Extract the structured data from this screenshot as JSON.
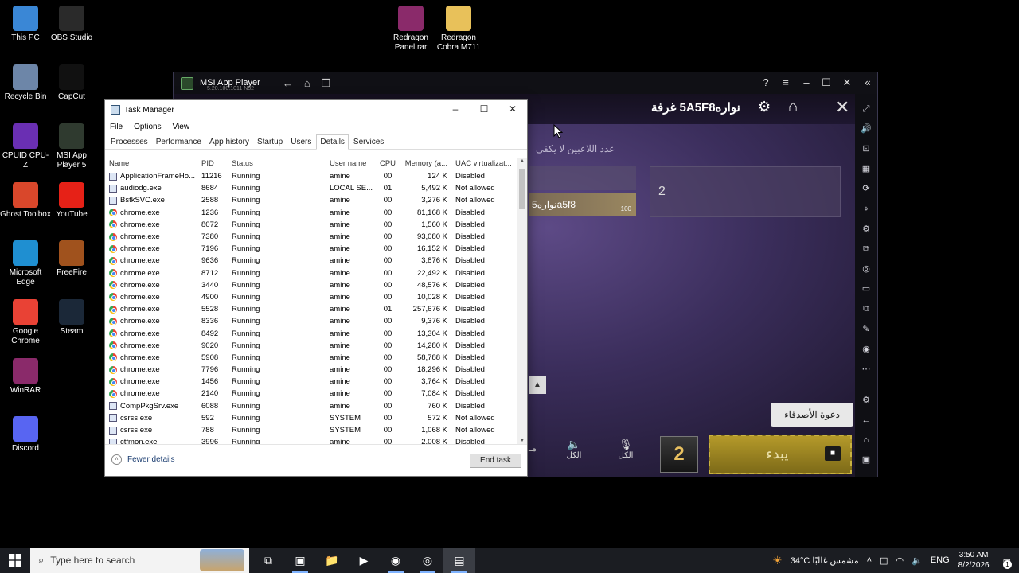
{
  "desktop": {
    "icons": [
      {
        "label": "This PC",
        "icon": "this-pc-icon",
        "color": "#3a87d6"
      },
      {
        "label": "OBS Studio",
        "icon": "obs-icon",
        "color": "#2a2a2a"
      },
      {
        "label": "Recycle Bin",
        "icon": "recycle-bin-icon",
        "color": "#6d86a8"
      },
      {
        "label": "CapCut",
        "icon": "capcut-icon",
        "color": "#111111"
      },
      {
        "label": "CPUID CPU-Z",
        "icon": "cpu-z-icon",
        "color": "#6a2fb3"
      },
      {
        "label": "MSI App Player 5",
        "icon": "msi-app-player-icon",
        "color": "#2f3a2f"
      },
      {
        "label": "Ghost Toolbox",
        "icon": "ghost-toolbox-icon",
        "color": "#d9472b"
      },
      {
        "label": "YouTube",
        "icon": "youtube-icon",
        "color": "#e62117"
      },
      {
        "label": "Microsoft Edge",
        "icon": "edge-icon",
        "color": "#1f8fd1"
      },
      {
        "label": "FreeFire",
        "icon": "freefire-icon",
        "color": "#a0521d"
      },
      {
        "label": "Google Chrome",
        "icon": "chrome-icon",
        "color": "#e94235"
      },
      {
        "label": "Steam",
        "icon": "steam-icon",
        "color": "#1b2838"
      },
      {
        "label": "WinRAR",
        "icon": "winrar-icon",
        "color": "#8a2a6a"
      },
      {
        "label": "Discord",
        "icon": "discord-icon",
        "color": "#5865f2"
      },
      {
        "label": "Redragon Panel.rar",
        "icon": "winrar-archive-icon",
        "color": "#8a2a6a"
      },
      {
        "label": "Redragon Cobra M711",
        "icon": "folder-icon",
        "color": "#e8c15a"
      }
    ]
  },
  "msi_player": {
    "title": "MSI App Player",
    "subtitle": "5.20.100.1011 N32",
    "nav": [
      "←",
      "⌂",
      "❐"
    ],
    "controls": [
      "?",
      "≡",
      "–",
      "☐",
      "✕",
      "«"
    ],
    "sidebar": [
      "⤢",
      "🔊",
      "⊡",
      "▦",
      "⟳",
      "⌖",
      "⚙",
      "⧉",
      "◎",
      "▭",
      "⧉",
      "✎",
      "◉",
      "⋯"
    ],
    "sidebar_bottom": [
      "⚙",
      "←",
      "⌂",
      "▣"
    ]
  },
  "game": {
    "room_title": "نواره5A5F8 غرفة",
    "players_warning": "عدد اللاعبين لا يكفي",
    "player_name": "نواره5a5f8",
    "player_level": "100",
    "slot_number": "2",
    "invite_label": "دعوة الأصدقاء",
    "start_label": "يبدء",
    "mic_all": "الكل",
    "speaker_all": "الكل",
    "partial_left": "مـ"
  },
  "task_manager": {
    "title": "Task Manager",
    "menu": [
      "File",
      "Options",
      "View"
    ],
    "tabs": [
      "Processes",
      "Performance",
      "App history",
      "Startup",
      "Users",
      "Details",
      "Services"
    ],
    "active_tab": "Details",
    "columns": [
      "Name",
      "PID",
      "Status",
      "User name",
      "CPU",
      "Memory (a...",
      "UAC virtualizat..."
    ],
    "rows": [
      {
        "name": "ApplicationFrameHo...",
        "pid": "11216",
        "status": "Running",
        "user": "amine",
        "cpu": "00",
        "mem": "124 K",
        "uac": "Disabled",
        "icon": "app"
      },
      {
        "name": "audiodg.exe",
        "pid": "8684",
        "status": "Running",
        "user": "LOCAL SE...",
        "cpu": "01",
        "mem": "5,492 K",
        "uac": "Not allowed",
        "icon": "app"
      },
      {
        "name": "BstkSVC.exe",
        "pid": "2588",
        "status": "Running",
        "user": "amine",
        "cpu": "00",
        "mem": "3,276 K",
        "uac": "Not allowed",
        "icon": "app"
      },
      {
        "name": "chrome.exe",
        "pid": "1236",
        "status": "Running",
        "user": "amine",
        "cpu": "00",
        "mem": "81,168 K",
        "uac": "Disabled",
        "icon": "chrome"
      },
      {
        "name": "chrome.exe",
        "pid": "8072",
        "status": "Running",
        "user": "amine",
        "cpu": "00",
        "mem": "1,560 K",
        "uac": "Disabled",
        "icon": "chrome"
      },
      {
        "name": "chrome.exe",
        "pid": "7380",
        "status": "Running",
        "user": "amine",
        "cpu": "00",
        "mem": "93,080 K",
        "uac": "Disabled",
        "icon": "chrome"
      },
      {
        "name": "chrome.exe",
        "pid": "7196",
        "status": "Running",
        "user": "amine",
        "cpu": "00",
        "mem": "16,152 K",
        "uac": "Disabled",
        "icon": "chrome"
      },
      {
        "name": "chrome.exe",
        "pid": "9636",
        "status": "Running",
        "user": "amine",
        "cpu": "00",
        "mem": "3,876 K",
        "uac": "Disabled",
        "icon": "chrome"
      },
      {
        "name": "chrome.exe",
        "pid": "8712",
        "status": "Running",
        "user": "amine",
        "cpu": "00",
        "mem": "22,492 K",
        "uac": "Disabled",
        "icon": "chrome"
      },
      {
        "name": "chrome.exe",
        "pid": "3440",
        "status": "Running",
        "user": "amine",
        "cpu": "00",
        "mem": "48,576 K",
        "uac": "Disabled",
        "icon": "chrome"
      },
      {
        "name": "chrome.exe",
        "pid": "4900",
        "status": "Running",
        "user": "amine",
        "cpu": "00",
        "mem": "10,028 K",
        "uac": "Disabled",
        "icon": "chrome"
      },
      {
        "name": "chrome.exe",
        "pid": "5528",
        "status": "Running",
        "user": "amine",
        "cpu": "01",
        "mem": "257,676 K",
        "uac": "Disabled",
        "icon": "chrome"
      },
      {
        "name": "chrome.exe",
        "pid": "8336",
        "status": "Running",
        "user": "amine",
        "cpu": "00",
        "mem": "9,376 K",
        "uac": "Disabled",
        "icon": "chrome"
      },
      {
        "name": "chrome.exe",
        "pid": "8492",
        "status": "Running",
        "user": "amine",
        "cpu": "00",
        "mem": "13,304 K",
        "uac": "Disabled",
        "icon": "chrome"
      },
      {
        "name": "chrome.exe",
        "pid": "9020",
        "status": "Running",
        "user": "amine",
        "cpu": "00",
        "mem": "14,280 K",
        "uac": "Disabled",
        "icon": "chrome"
      },
      {
        "name": "chrome.exe",
        "pid": "5908",
        "status": "Running",
        "user": "amine",
        "cpu": "00",
        "mem": "58,788 K",
        "uac": "Disabled",
        "icon": "chrome"
      },
      {
        "name": "chrome.exe",
        "pid": "7796",
        "status": "Running",
        "user": "amine",
        "cpu": "00",
        "mem": "18,296 K",
        "uac": "Disabled",
        "icon": "chrome"
      },
      {
        "name": "chrome.exe",
        "pid": "1456",
        "status": "Running",
        "user": "amine",
        "cpu": "00",
        "mem": "3,764 K",
        "uac": "Disabled",
        "icon": "chrome"
      },
      {
        "name": "chrome.exe",
        "pid": "2140",
        "status": "Running",
        "user": "amine",
        "cpu": "00",
        "mem": "7,084 K",
        "uac": "Disabled",
        "icon": "chrome"
      },
      {
        "name": "CompPkgSrv.exe",
        "pid": "6088",
        "status": "Running",
        "user": "amine",
        "cpu": "00",
        "mem": "760 K",
        "uac": "Disabled",
        "icon": "app"
      },
      {
        "name": "csrss.exe",
        "pid": "592",
        "status": "Running",
        "user": "SYSTEM",
        "cpu": "00",
        "mem": "572 K",
        "uac": "Not allowed",
        "icon": "app"
      },
      {
        "name": "csrss.exe",
        "pid": "788",
        "status": "Running",
        "user": "SYSTEM",
        "cpu": "00",
        "mem": "1,068 K",
        "uac": "Not allowed",
        "icon": "app"
      },
      {
        "name": "ctfmon.exe",
        "pid": "3996",
        "status": "Running",
        "user": "amine",
        "cpu": "00",
        "mem": "2,008 K",
        "uac": "Disabled",
        "icon": "app"
      }
    ],
    "fewer_details": "Fewer details",
    "end_task": "End task"
  },
  "taskbar": {
    "search_placeholder": "Type here to search",
    "apps": [
      {
        "icon": "task-view-icon",
        "glyph": "⧉",
        "running": false,
        "active": false
      },
      {
        "icon": "msi-app-player-icon",
        "glyph": "▣",
        "running": true,
        "active": false
      },
      {
        "icon": "file-explorer-icon",
        "glyph": "📁",
        "running": false,
        "active": false
      },
      {
        "icon": "youtube-icon",
        "glyph": "▶",
        "running": false,
        "active": false
      },
      {
        "icon": "chrome-icon",
        "glyph": "◉",
        "running": true,
        "active": false
      },
      {
        "icon": "obs-icon",
        "glyph": "◎",
        "running": true,
        "active": false
      },
      {
        "icon": "task-manager-icon",
        "glyph": "▤",
        "running": true,
        "active": true
      }
    ],
    "weather": "34°C  مشمس غالبًا",
    "language": "ENG",
    "time": "3:50 AM",
    "date": "8/2/2026",
    "notification_count": "1"
  }
}
